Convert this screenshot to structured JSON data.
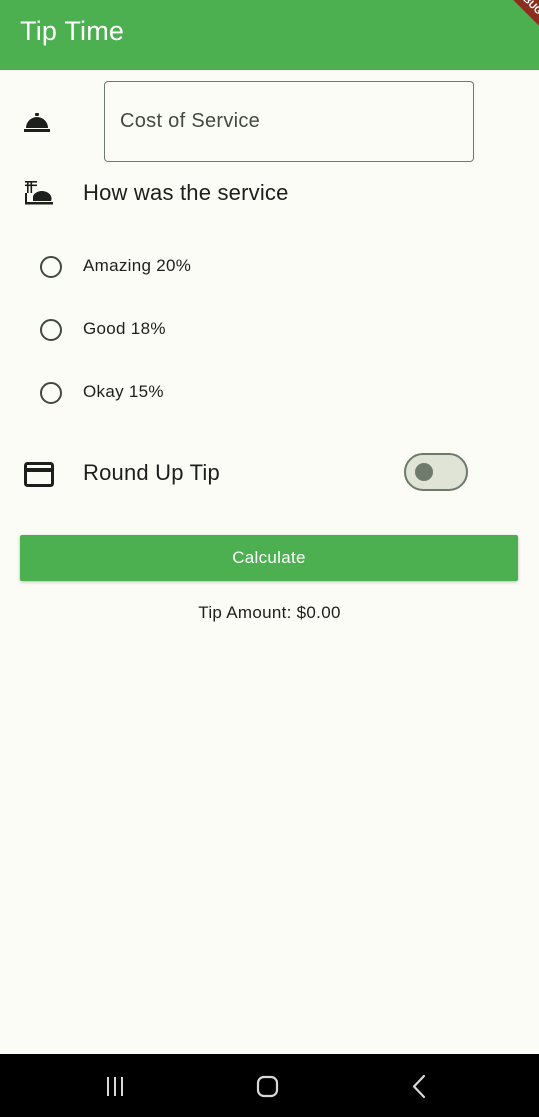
{
  "app_bar": {
    "title": "Tip Time",
    "color": "#4caf50",
    "debug_banner": "DEBUG"
  },
  "cost_input": {
    "placeholder": "Cost of Service",
    "value": "",
    "icon": "room-service-icon"
  },
  "service_question": {
    "label": "How was the service",
    "icon": "dinner-dining-icon"
  },
  "tip_options": [
    {
      "label": "Amazing 20%",
      "selected": false
    },
    {
      "label": "Good 18%",
      "selected": false
    },
    {
      "label": "Okay 15%",
      "selected": false
    }
  ],
  "round_up": {
    "label": "Round Up Tip",
    "icon": "credit-card-icon",
    "enabled": false
  },
  "calculate_button": {
    "label": "Calculate"
  },
  "result": {
    "text": "Tip Amount: $0.00"
  },
  "system_nav": {
    "buttons": [
      "recent-apps-icon",
      "home-icon",
      "back-icon"
    ]
  }
}
